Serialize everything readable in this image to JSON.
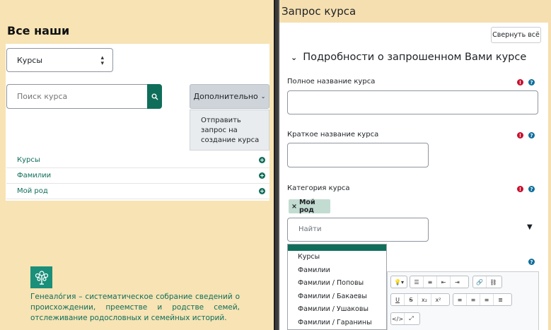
{
  "left": {
    "title": "Все наши",
    "course_select": {
      "value": "Курсы"
    },
    "search": {
      "placeholder": "Поиск курса"
    },
    "more_button": "Дополнительно",
    "more_menu_item": "Отправить запрос на создание курса",
    "nav_items": [
      "Курсы",
      "Фамилии",
      "Мой род"
    ],
    "footer": "Генеало́гия – систематическое собрание сведений о происхождении, преемстве и родстве семей, отслеживание родословных и семейных историй."
  },
  "right": {
    "title": "Запрос курса",
    "collapse_all": "Свернуть всё",
    "section_title": "Подробности о запрошенном Вами курсе",
    "fields": {
      "full_name_label": "Полное название курса",
      "short_name_label": "Краткое название курса",
      "category_label": "Категория курса"
    },
    "category_tag": "Мой род",
    "find_placeholder": "Найти",
    "dropdown_options": [
      "Курсы",
      "Фамилии",
      "Фамилии / Поповы",
      "Фамилии / Бакаевы",
      "Фамилии / Ушаковы",
      "Фамилии / Гаранины"
    ]
  },
  "colors": {
    "accent": "#0f6e5a",
    "required": "#c8102e",
    "help": "#0f6e9a",
    "background": "#f5deb0"
  }
}
